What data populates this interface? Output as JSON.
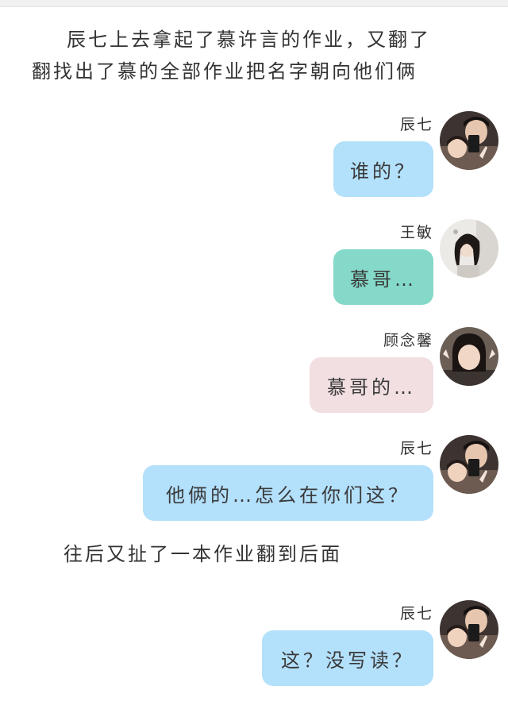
{
  "narration": {
    "line1": "辰七上去拿起了慕许言的作业，又翻了",
    "line2": "翻找出了慕的全部作业把名字朝向他们俩",
    "line3": "往后又扯了一本作业翻到后面"
  },
  "messages": [
    {
      "sender": "辰七",
      "text": "谁的？",
      "bubble_color": "#b3e0fb",
      "avatar_icon": "couple-selfie-avatar-icon"
    },
    {
      "sender": "王敏",
      "text": "慕哥…",
      "bubble_color": "#84d9c8",
      "avatar_icon": "girl-portrait-avatar-icon"
    },
    {
      "sender": "顾念馨",
      "text": "慕哥的…",
      "bubble_color": "#f2dfe2",
      "avatar_icon": "girl-bob-hair-avatar-icon"
    },
    {
      "sender": "辰七",
      "text": "他俩的…怎么在你们这？",
      "bubble_color": "#b3e0fb",
      "avatar_icon": "couple-selfie-avatar-icon"
    },
    {
      "sender": "辰七",
      "text": "这？没写读？",
      "bubble_color": "#b3e0fb",
      "avatar_icon": "couple-selfie-avatar-icon"
    }
  ]
}
